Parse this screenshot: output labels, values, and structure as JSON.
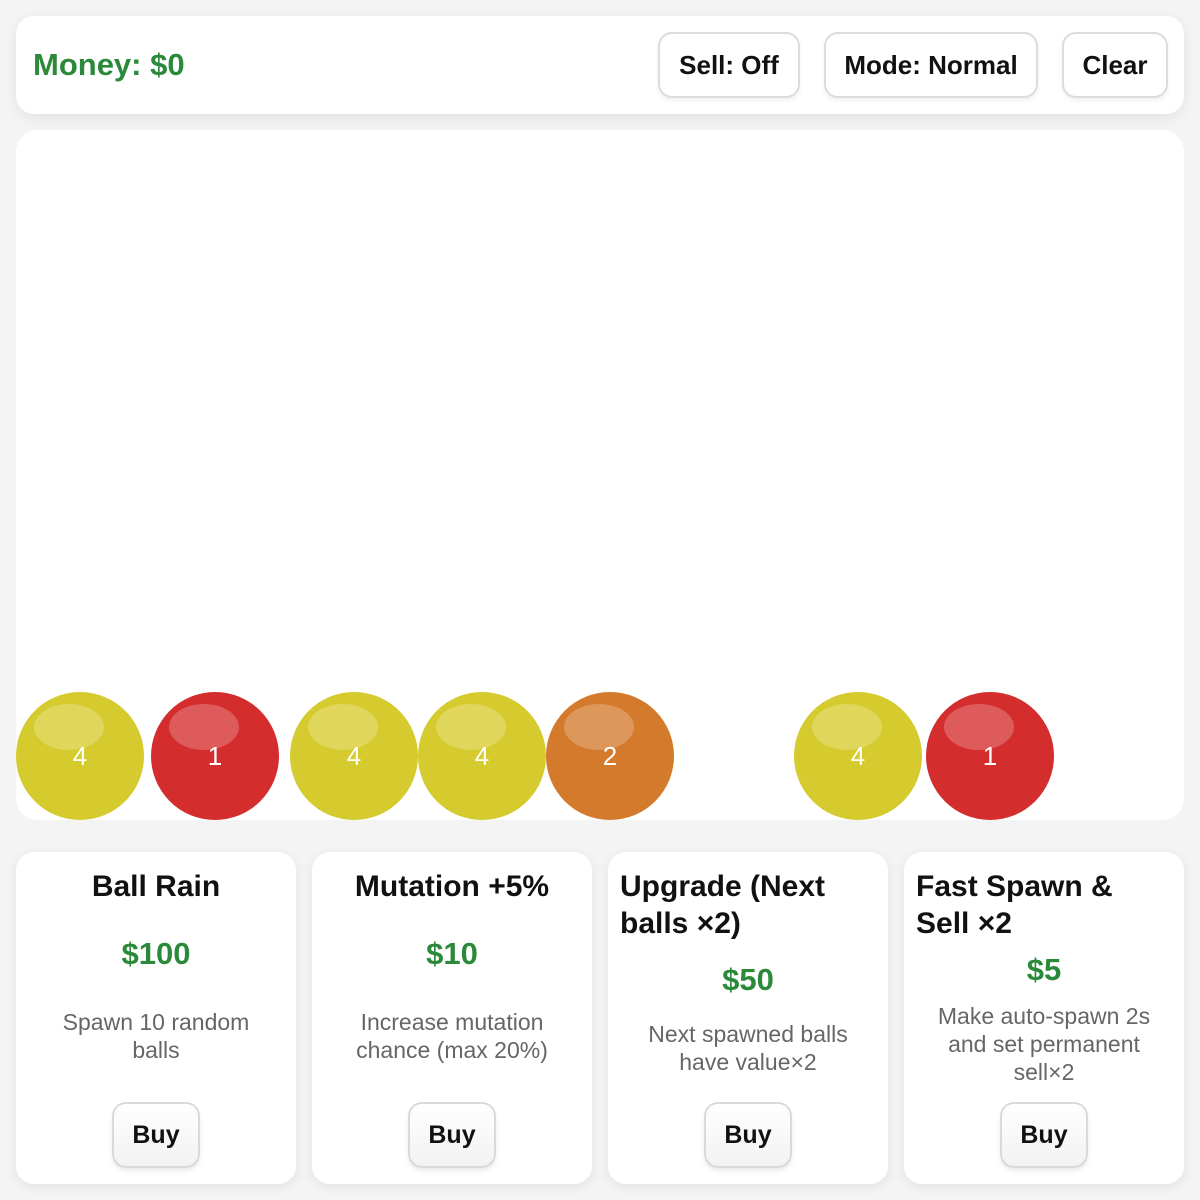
{
  "header": {
    "money_label": "Money: $0",
    "sell_button": "Sell: Off",
    "mode_button": "Mode: Normal",
    "clear_button": "Clear"
  },
  "colors": {
    "money_green": "#2a8a3a",
    "ball_yellow": "#d6cb2e",
    "ball_red": "#d42d2e",
    "ball_orange": "#d47a2c"
  },
  "balls": [
    {
      "value": "4",
      "color": "yellow"
    },
    {
      "value": "1",
      "color": "red"
    },
    {
      "value": "4",
      "color": "yellow"
    },
    {
      "value": "4",
      "color": "yellow"
    },
    {
      "value": "2",
      "color": "orange"
    },
    {
      "value": "4",
      "color": "yellow"
    },
    {
      "value": "1",
      "color": "red"
    }
  ],
  "shop": [
    {
      "title": "Ball Rain",
      "price": "$100",
      "description": "Spawn 10 random balls",
      "buy_label": "Buy"
    },
    {
      "title": "Mutation +5%",
      "price": "$10",
      "description": "Increase mutation chance (max 20%)",
      "buy_label": "Buy"
    },
    {
      "title": "Upgrade (Next balls ×2)",
      "price": "$50",
      "description": "Next spawned balls have value×2",
      "buy_label": "Buy"
    },
    {
      "title": "Fast Spawn & Sell ×2",
      "price": "$5",
      "description": "Make auto-spawn 2s and set permanent sell×2",
      "buy_label": "Buy"
    }
  ]
}
